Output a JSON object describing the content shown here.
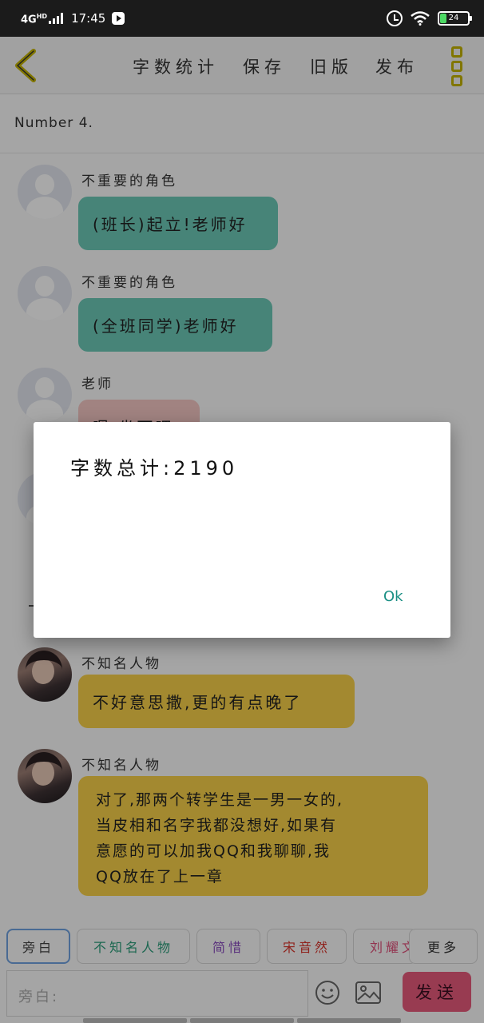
{
  "status_bar": {
    "network": "4G",
    "network_sup": "HD",
    "time": "17:45",
    "battery": "24",
    "battery_level": 0.24
  },
  "toolbar": {
    "items": [
      "字数统计",
      "保存",
      "旧版",
      "发布"
    ]
  },
  "story_title": "Number 4.",
  "messages": [
    {
      "sender": "不重要的角色",
      "text": "(班长)起立!老师好",
      "avatar": "default",
      "color": "#6cc8b7"
    },
    {
      "sender": "不重要的角色",
      "text": "(全班同学)老师好",
      "avatar": "default",
      "color": "#6cc8b7"
    },
    {
      "sender": "老师",
      "text": "嗯,坐下吧",
      "avatar": "default",
      "color": "#f4c7c4"
    },
    {
      "sender": "不知名人物",
      "text": "不好意思撒,更的有点晚了",
      "avatar": "photo",
      "color": "#f7d14a"
    },
    {
      "sender": "不知名人物",
      "lines": [
        "对了,那两个转学生是一男一女的,",
        "当皮相和名字我都没想好,如果有",
        "意愿的可以加我QQ和我聊聊,我",
        "QQ放在了上一章"
      ],
      "avatar": "photo",
      "color": "#f7d14a"
    }
  ],
  "role_chips": [
    {
      "label": "旁白",
      "color": "#444444"
    },
    {
      "label": "不知名人物",
      "color": "#2a9d7a"
    },
    {
      "label": "简惜",
      "color": "#8b4dbf"
    },
    {
      "label": "宋音然",
      "color": "#d9342b"
    },
    {
      "label": "刘耀文",
      "color": "#e0507a"
    },
    {
      "label": "更多",
      "color": "#333333"
    }
  ],
  "input": {
    "placeholder": "旁白:"
  },
  "send_label": "发送",
  "dialog": {
    "message": "字数总计:2190",
    "ok_label": "Ok"
  }
}
